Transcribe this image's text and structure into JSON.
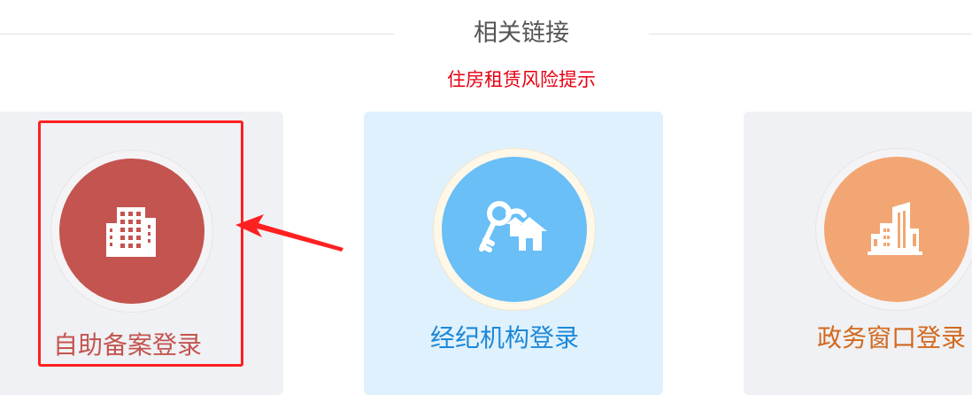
{
  "section": {
    "title": "相关链接"
  },
  "notice": {
    "risk_label": "住房租赁风险提示"
  },
  "cards": [
    {
      "label": "自助备案登录",
      "icon": "building-icon",
      "color": "#c4544f"
    },
    {
      "label": "经纪机构登录",
      "icon": "keys-house-icon",
      "color": "#1d88d6"
    },
    {
      "label": "政务窗口登录",
      "icon": "government-building-icon",
      "color": "#d2691e"
    }
  ],
  "annotation": {
    "highlight_color": "#ff2020"
  }
}
